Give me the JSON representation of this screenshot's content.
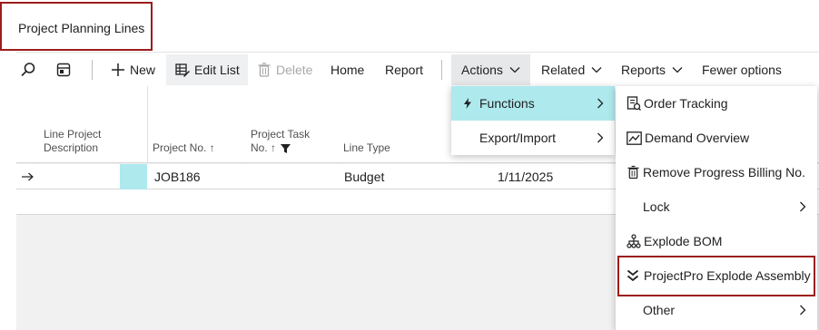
{
  "page": {
    "title": "Project Planning Lines"
  },
  "toolbar": {
    "new_label": "New",
    "edit_list_label": "Edit List",
    "delete_label": "Delete",
    "home_label": "Home",
    "report_label": "Report",
    "actions_label": "Actions",
    "related_label": "Related",
    "reports_label": "Reports",
    "fewer_options_label": "Fewer options"
  },
  "grid": {
    "columns": {
      "line_project_description": "Line Project Description",
      "project_no": "Project No. ↑",
      "project_task_no": "Project Task No. ↑",
      "line_type": "Line Type"
    },
    "rows": [
      {
        "project_no": "JOB186",
        "line_type": "Budget",
        "date": "1/11/2025"
      },
      {
        "project_no": "",
        "line_type": "",
        "date": ""
      }
    ]
  },
  "actions_menu": {
    "items": [
      "Functions",
      "Export/Import"
    ]
  },
  "functions_submenu": {
    "items": [
      "Order Tracking",
      "Demand Overview",
      "Remove Progress Billing No.",
      "Lock",
      "Explode BOM",
      "ProjectPro Explode Assembly",
      "Other"
    ]
  },
  "colors": {
    "accent": "#aee9ee",
    "highlight_border": "#9c1c1c"
  }
}
